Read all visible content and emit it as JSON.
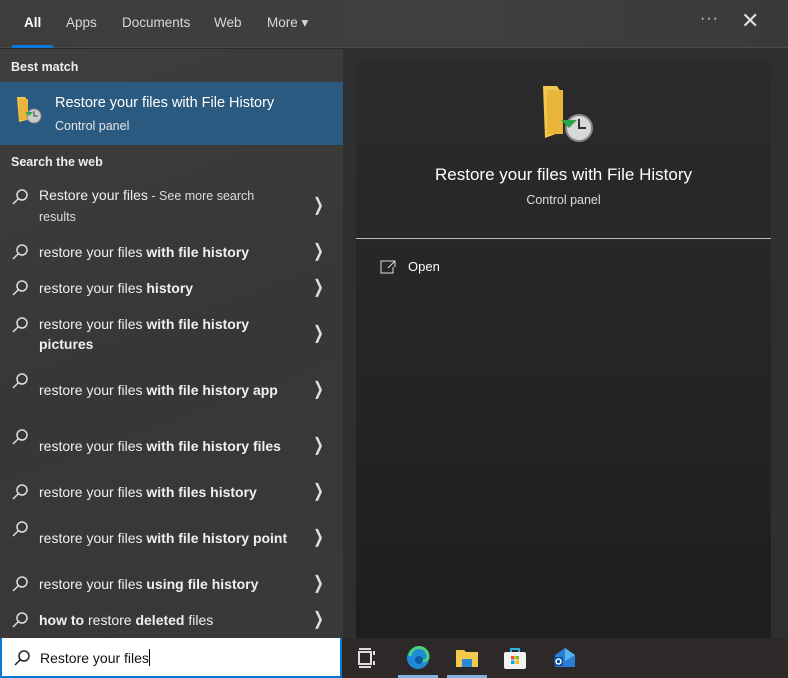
{
  "tabs": [
    {
      "label": "All",
      "active": true
    },
    {
      "label": "Apps"
    },
    {
      "label": "Documents"
    },
    {
      "label": "Web"
    },
    {
      "label": "More ▾"
    }
  ],
  "more_options": "···",
  "close": "✕",
  "best_match": {
    "header": "Best match",
    "title": "Restore your files with File History",
    "subtitle": "Control panel"
  },
  "search_web": {
    "header": "Search the web",
    "items": [
      {
        "lines": 2,
        "segments": [
          {
            "t": "Restore your files"
          },
          {
            "t": " - See more search results",
            "sm": true
          }
        ]
      },
      {
        "lines": 1,
        "segments": [
          {
            "t": "restore your files "
          },
          {
            "t": "with file history",
            "b": true
          }
        ]
      },
      {
        "lines": 1,
        "segments": [
          {
            "t": "restore your files "
          },
          {
            "t": "history",
            "b": true
          }
        ]
      },
      {
        "lines": 2,
        "segments": [
          {
            "t": "restore your files "
          },
          {
            "t": "with file history pictures",
            "b": true
          }
        ]
      },
      {
        "lines": 2,
        "segments": [
          {
            "t": "restore your files "
          },
          {
            "t": "with file history app",
            "b": true
          }
        ]
      },
      {
        "lines": 2,
        "segments": [
          {
            "t": "restore your files "
          },
          {
            "t": "with file history files",
            "b": true
          }
        ]
      },
      {
        "lines": 1,
        "segments": [
          {
            "t": "restore your files "
          },
          {
            "t": "with files history",
            "b": true
          }
        ]
      },
      {
        "lines": 2,
        "segments": [
          {
            "t": "restore your files "
          },
          {
            "t": "with file history point",
            "b": true
          }
        ]
      },
      {
        "lines": 1,
        "segments": [
          {
            "t": "restore your files "
          },
          {
            "t": "using file history",
            "b": true
          }
        ]
      },
      {
        "lines": 1,
        "segments": [
          {
            "t": "how to",
            "b": true
          },
          {
            "t": " restore "
          },
          {
            "t": "deleted",
            "b": true
          },
          {
            "t": " files"
          }
        ]
      }
    ]
  },
  "preview": {
    "title": "Restore your files with File History",
    "subtitle": "Control panel",
    "action": "Open"
  },
  "search_box": {
    "value": "Restore your files"
  },
  "colors": {
    "accent": "#0a78d4",
    "highlight": "#2b5a80"
  }
}
